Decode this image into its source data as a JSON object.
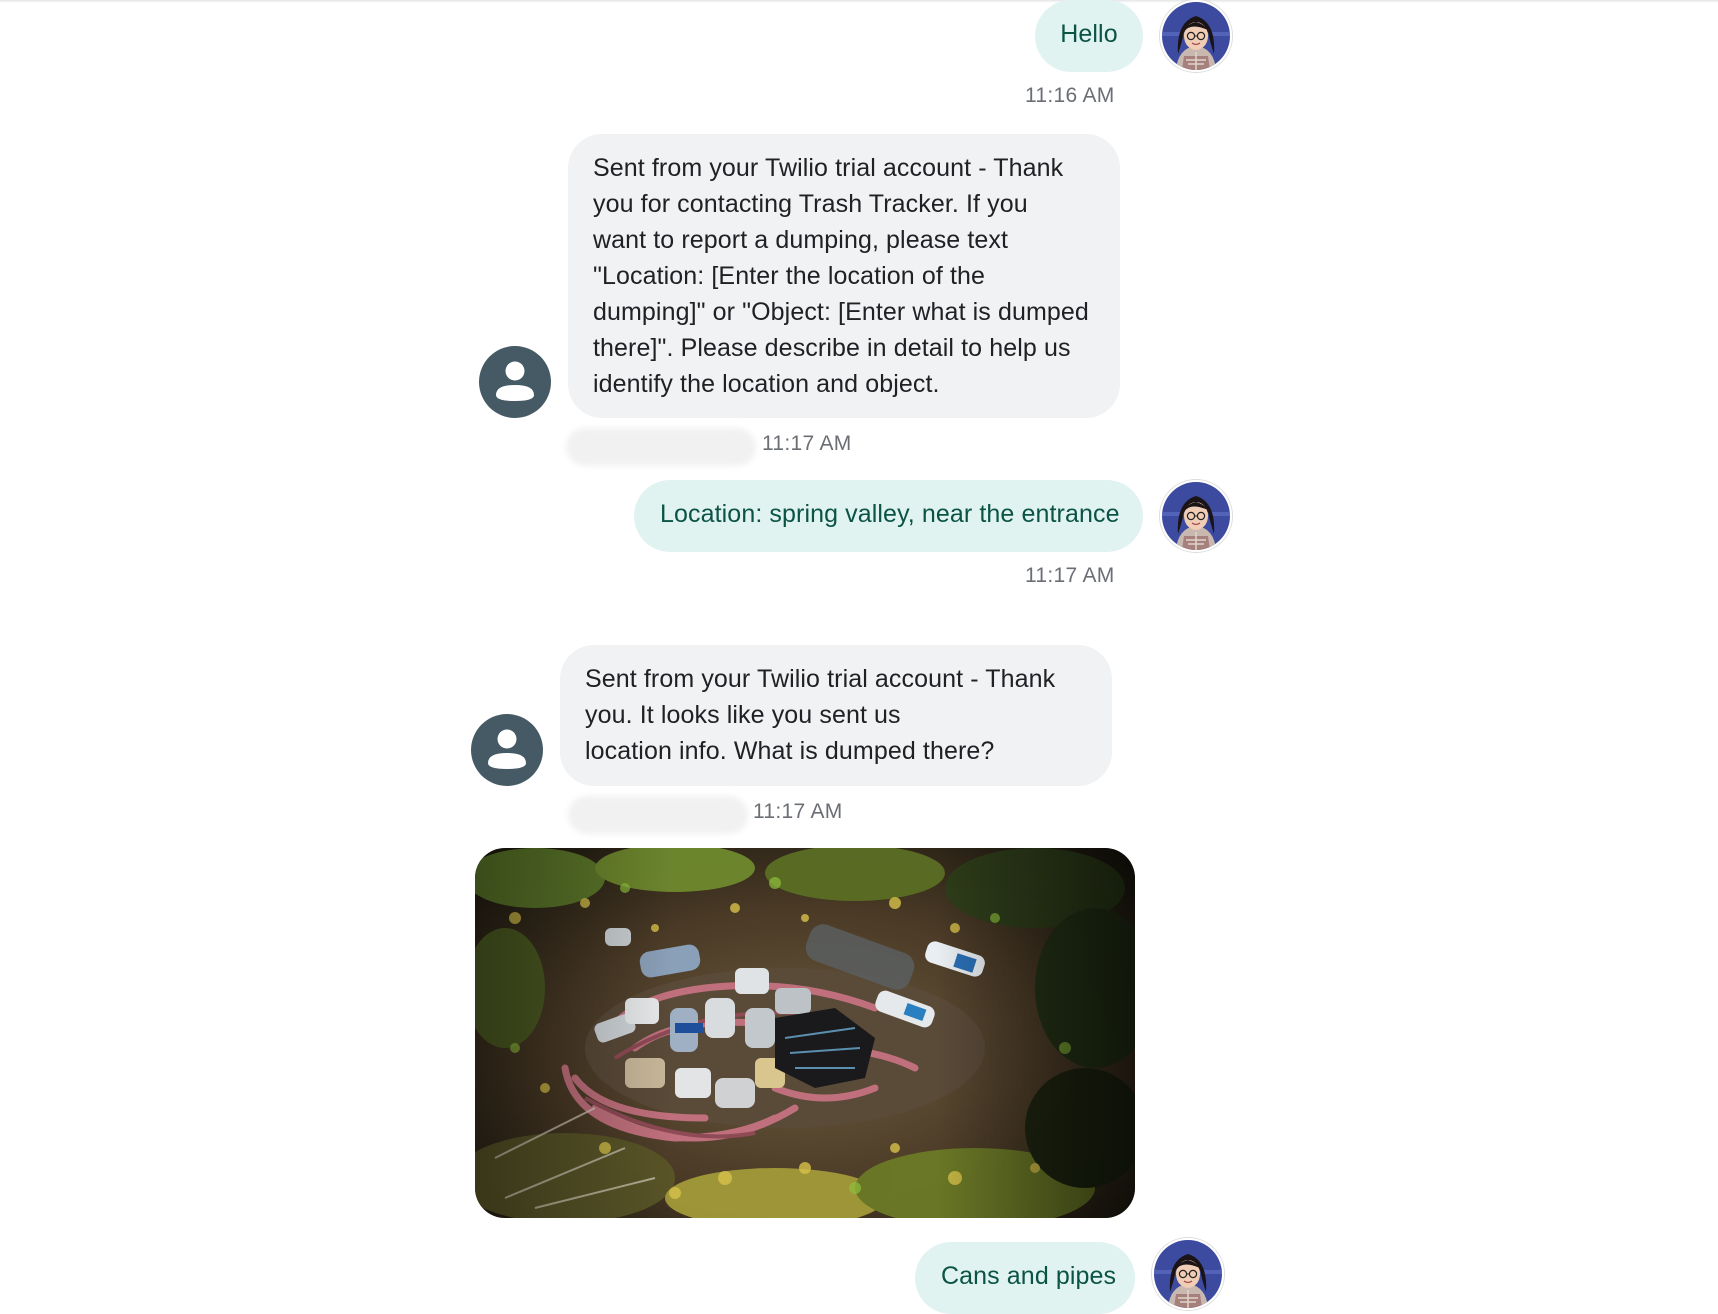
{
  "messages": [
    {
      "direction": "outgoing",
      "text": "Hello",
      "time": "11:16 AM"
    },
    {
      "direction": "incoming",
      "text": "Sent from your Twilio trial account - Thank\nyou for contacting Trash Tracker. If you\nwant to report a dumping, please text\n\"Location: [Enter the location of the\ndumping]\" or \"Object: [Enter what is dumped\nthere]\". Please describe in detail to help us\nidentify the location and object.",
      "time": "11:17 AM"
    },
    {
      "direction": "outgoing",
      "text": "Location: spring valley, near the entrance",
      "time": "11:17 AM"
    },
    {
      "direction": "incoming",
      "text": "Sent from your Twilio trial account - Thank\nyou. It looks like you sent us\nlocation info. What is dumped there?",
      "time": "11:17 AM"
    },
    {
      "direction": "outgoing",
      "text": "Cans and pipes"
    }
  ],
  "icons": {
    "user_avatar": "user-photo-avatar",
    "bot_avatar": "account-circle-icon",
    "attachment": "trash-pile-photo"
  },
  "colors": {
    "outgoing_bubble": "#e0f3f0",
    "outgoing_text": "#0b5345",
    "incoming_bubble": "#f1f2f4",
    "incoming_text": "#202124",
    "bot_icon": "#455a64",
    "timestamp": "#6b6f74"
  }
}
